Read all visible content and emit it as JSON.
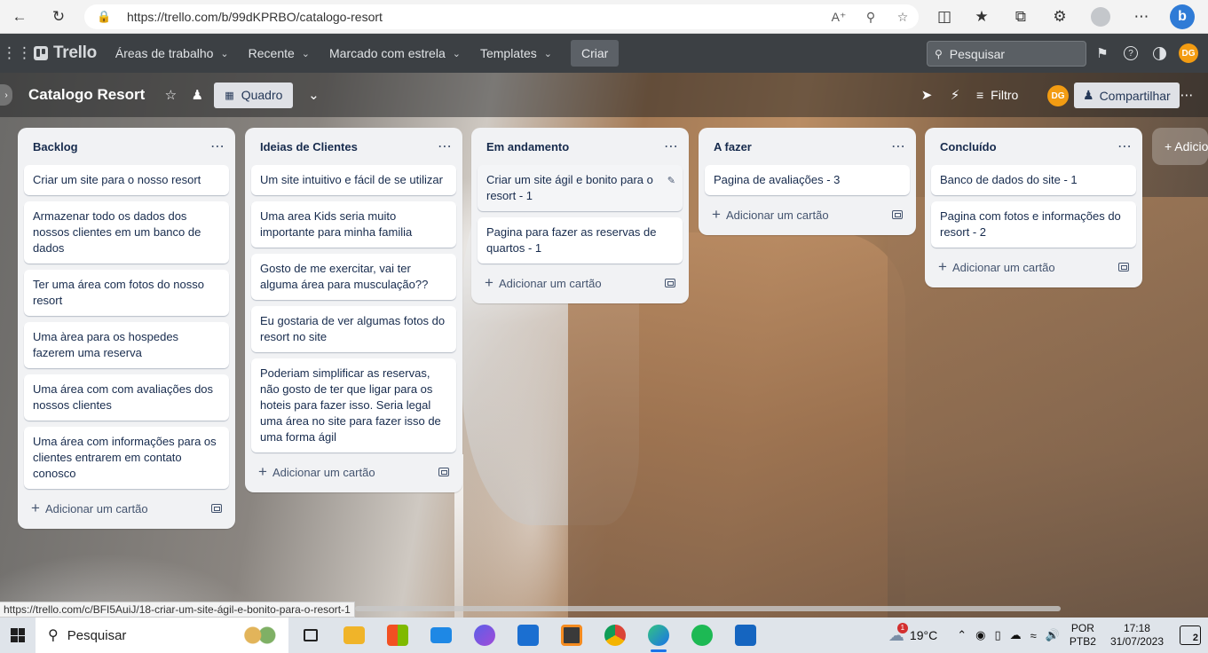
{
  "browser": {
    "url": "https://trello.com/b/99dKPRBO/catalogo-resort"
  },
  "nav": {
    "brand": "Trello",
    "workspaces": "Áreas de trabalho",
    "recent": "Recente",
    "starred": "Marcado com estrela",
    "templates": "Templates",
    "create": "Criar",
    "search_placeholder": "Pesquisar",
    "avatar_initials": "DG"
  },
  "board": {
    "title": "Catalogo Resort",
    "view": "Quadro",
    "filter": "Filtro",
    "share": "Compartilhar",
    "member_initials": "DG",
    "add_list": "+ Adicio"
  },
  "lists": [
    {
      "title": "Backlog",
      "cards": [
        "Criar um site para o nosso resort",
        "Armazenar todo os dados dos nossos clientes em um banco de dados",
        "Ter uma área com fotos do nosso resort",
        "Uma àrea para os hospedes fazerem uma reserva",
        "Uma área com com avaliações dos nossos clientes",
        "Uma área com informações para os clientes entrarem em contato conosco"
      ],
      "add_card": "Adicionar um cartão"
    },
    {
      "title": "Ideias de Clientes",
      "cards": [
        "Um site intuitivo e fácil de se utilizar",
        "Uma area Kids seria muito importante para minha familia",
        "Gosto de me exercitar, vai ter alguma área para musculação??",
        "Eu gostaria de ver algumas fotos do resort no site",
        "Poderiam simplificar as reservas, não gosto de ter que ligar para os hoteis para fazer isso. Seria legal uma área no site para fazer isso de uma forma ágil"
      ],
      "add_card": "Adicionar um cartão"
    },
    {
      "title": "Em andamento",
      "cards": [
        "Criar um site ágil e bonito para o resort - 1",
        "Pagina para fazer as reservas de quartos - 1"
      ],
      "add_card": "Adicionar um cartão"
    },
    {
      "title": "A fazer",
      "cards": [
        "Pagina de avaliações - 3"
      ],
      "add_card": "Adicionar um cartão"
    },
    {
      "title": "Concluído",
      "cards": [
        "Banco de dados do site - 1",
        "Pagina com fotos e informações do resort - 2"
      ],
      "add_card": "Adicionar um cartão"
    }
  ],
  "status_url": "https://trello.com/c/BFI5AuiJ/18-criar-um-site-ágil-e-bonito-para-o-resort-1",
  "taskbar": {
    "search": "Pesquisar",
    "weather_temp": "19°C",
    "weather_badge": "1",
    "lang_top": "POR",
    "lang_bottom": "PTB2",
    "time": "17:18",
    "date": "31/07/2023",
    "notifications": "2"
  },
  "colors": {
    "trello_nav": "#3c4044",
    "list_bg": "#f1f2f4",
    "avatar": "#f39c12"
  }
}
